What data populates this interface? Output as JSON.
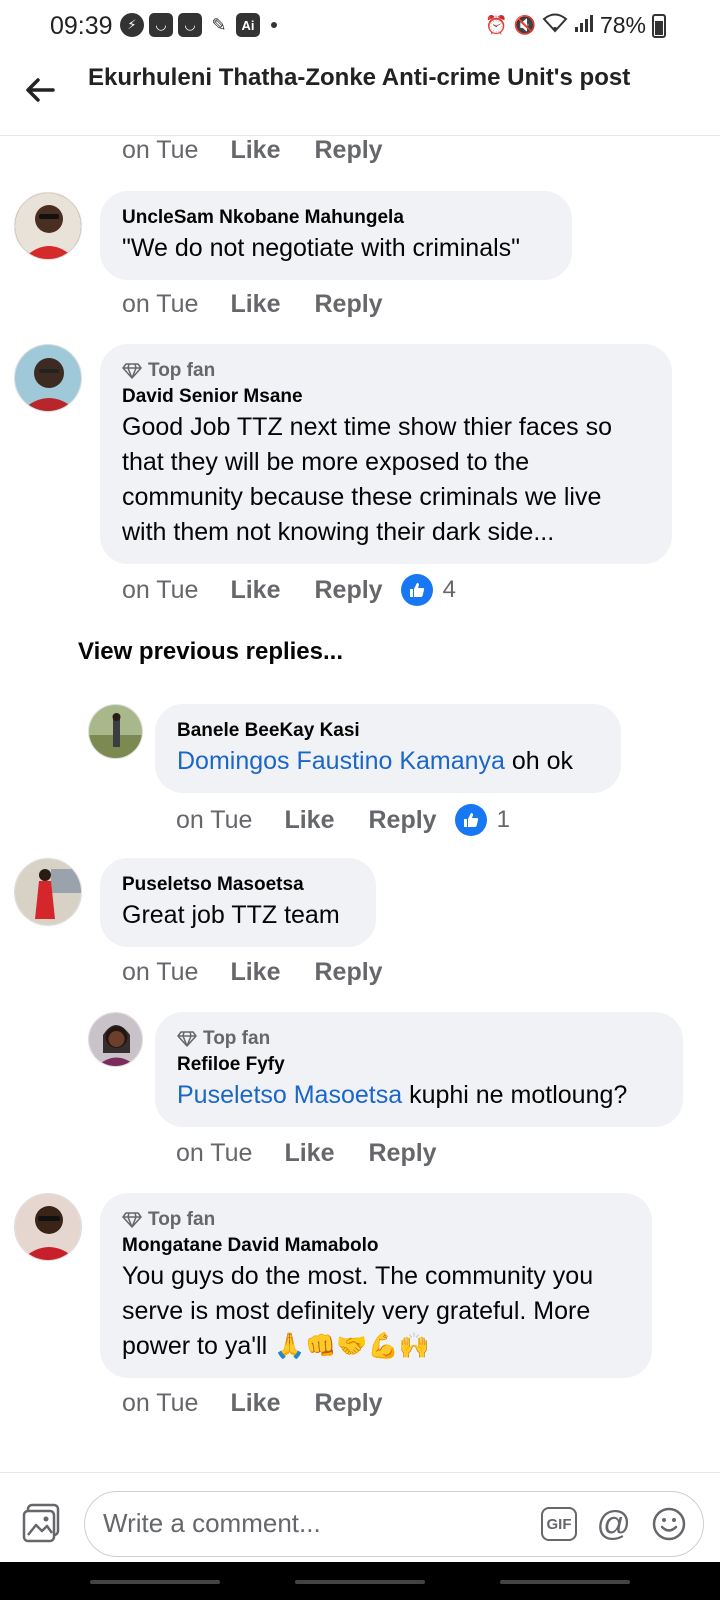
{
  "status": {
    "time": "09:39",
    "battery": "78%"
  },
  "header": {
    "title": "Ekurhuleni Thatha-Zonke Anti-crime Unit's post"
  },
  "comments": [
    {
      "author": "UncleSam Nkobane Mahungela",
      "text": "\"We do not negotiate with criminals\"",
      "time": "on Tue",
      "like": "Like",
      "reply": "Reply"
    },
    {
      "badge": "Top fan",
      "author": "David Senior Msane",
      "text": "Good Job TTZ next time show thier faces so that they will be more exposed to the community because these criminals we live with them not knowing their dark side...",
      "time": "on Tue",
      "like": "Like",
      "reply": "Reply",
      "reactions": "4"
    },
    {
      "author": "Puseletso Masoetsa",
      "text": "Great job TTZ team",
      "time": "on Tue",
      "like": "Like",
      "reply": "Reply"
    },
    {
      "badge": "Top fan",
      "author": "Mongatane David Mamabolo",
      "text": "You guys do the most. The community you serve is most definitely very grateful. More power to ya'll 🙏👊🤝💪🙌",
      "time": "on Tue",
      "like": "Like",
      "reply": "Reply"
    }
  ],
  "top_partial": {
    "time": "on Tue",
    "like": "Like",
    "reply": "Reply"
  },
  "view_previous": "View previous replies...",
  "replies": [
    {
      "author": "Banele BeeKay Kasi",
      "mention": "Domingos Faustino Kamanya",
      "text": " oh ok",
      "time": "on Tue",
      "like": "Like",
      "reply": "Reply",
      "reactions": "1"
    },
    {
      "badge": "Top fan",
      "author": "Refiloe Fyfy",
      "mention": "Puseletso Masoetsa",
      "text": " kuphi ne motloung?",
      "time": "on Tue",
      "like": "Like",
      "reply": "Reply"
    }
  ],
  "composer": {
    "placeholder": "Write a comment...",
    "gif_label": "GIF",
    "at_label": "@"
  },
  "icons": {
    "back": "arrow-left-icon",
    "photo": "photo-icon",
    "emoji": "emoji-icon",
    "like_badge": "thumbs-up-icon",
    "top_fan": "diamond-icon"
  },
  "colors": {
    "bubble": "#f0f2f5",
    "mention": "#1b66c9",
    "like_blue": "#1877f2",
    "meta_gray": "#65676b"
  }
}
